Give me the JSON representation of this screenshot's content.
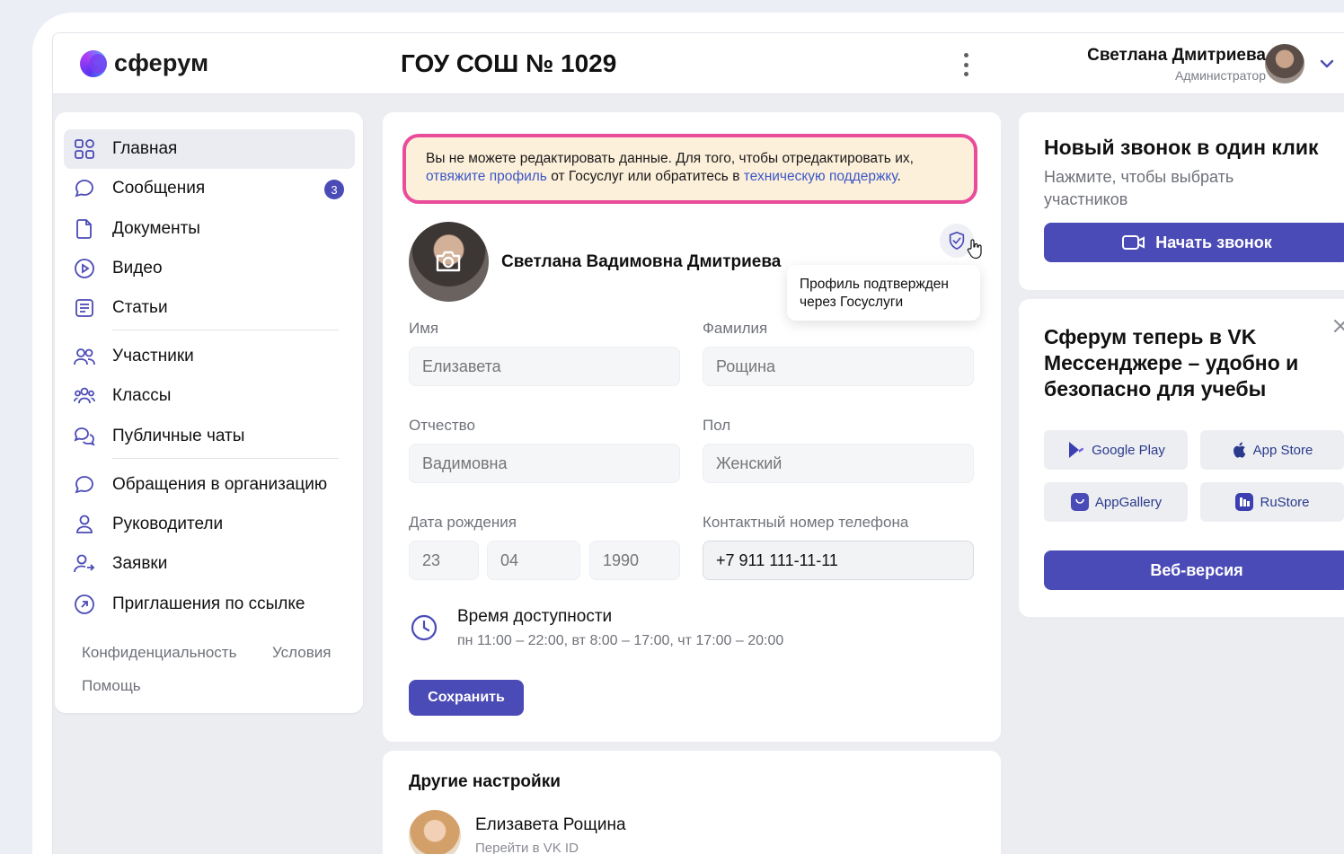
{
  "header": {
    "logo_text": "сферум",
    "org_title": "ГОУ СОШ № 1029",
    "user_name": "Светлана Дмитриева",
    "user_role": "Администратор"
  },
  "sidebar": {
    "items": [
      {
        "label": "Главная",
        "icon": "home-grid-icon"
      },
      {
        "label": "Сообщения",
        "icon": "chat-bubble-icon",
        "badge": "3"
      },
      {
        "label": "Документы",
        "icon": "document-icon"
      },
      {
        "label": "Видео",
        "icon": "play-circle-icon"
      },
      {
        "label": "Статьи",
        "icon": "article-icon"
      },
      {
        "label": "Участники",
        "icon": "users-icon"
      },
      {
        "label": "Классы",
        "icon": "class-group-icon"
      },
      {
        "label": "Публичные чаты",
        "icon": "public-chats-icon"
      },
      {
        "label": "Обращения в организацию",
        "icon": "appeal-bubble-icon"
      },
      {
        "label": "Руководители",
        "icon": "person-icon"
      },
      {
        "label": "Заявки",
        "icon": "requests-icon"
      },
      {
        "label": "Приглашения по ссылке",
        "icon": "link-arrow-icon"
      }
    ],
    "footer": {
      "privacy": "Конфиденциальность",
      "terms": "Условия",
      "help": "Помощь"
    }
  },
  "profile": {
    "warning_text_1": "Вы не можете редактировать данные. Для того, чтобы отредактировать их,",
    "warning_link_1": "отвяжите профиль",
    "warning_text_2": " от Госуслуг или обратитесь в ",
    "warning_link_2": "техническую поддержку",
    "warning_text_3": ".",
    "full_name": "Светлана Вадимовна Дмитриева",
    "tooltip": "Профиль подтвержден через Госуслуги",
    "fields": {
      "first_name_label": "Имя",
      "first_name_placeholder": "Елизавета",
      "last_name_label": "Фамилия",
      "last_name_placeholder": "Рощина",
      "patronymic_label": "Отчество",
      "patronymic_placeholder": "Вадимовна",
      "gender_label": "Пол",
      "gender_placeholder": "Женский",
      "birth_label": "Дата рождения",
      "birth_day": "23",
      "birth_month": "04",
      "birth_year": "1990",
      "phone_label": "Контактный номер телефона",
      "phone_value": "+7 911 111-11-11"
    },
    "availability_title": "Время доступности",
    "availability_value": "пн 11:00 – 22:00, вт 8:00 – 17:00, чт 17:00 – 20:00",
    "save_label": "Сохранить"
  },
  "other_settings": {
    "title": "Другие настройки",
    "linked_name": "Елизавета Рощина",
    "linked_sub": "Перейти в VK ID"
  },
  "call_card": {
    "title": "Новый звонок в один клик",
    "subtitle": "Нажмите, чтобы выбрать участников",
    "button": "Начать звонок"
  },
  "promo_card": {
    "title": "Сферум теперь в VK Мессенджере – удобно и безопасно для учебы",
    "stores": [
      "Google Play",
      "App Store",
      "AppGallery",
      "RuStore"
    ],
    "web_button": "Веб-версия"
  },
  "colors": {
    "accent": "#4b4bb7",
    "warning_border": "#e84c9b",
    "warning_bg": "#fdf0da",
    "link": "#3a57c7"
  }
}
